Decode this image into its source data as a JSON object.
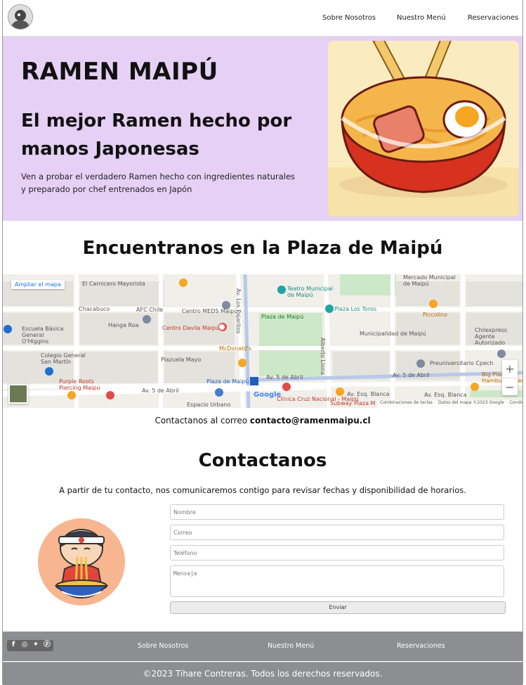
{
  "header": {
    "nav": [
      "Sobre Nosotros",
      "Nuestro Menú",
      "Reservaciones"
    ]
  },
  "hero": {
    "title": "RAMEN MAIPÚ",
    "subtitle": "El mejor Ramen hecho por manos Japonesas",
    "description": "Ven a probar el verdadero Ramen hecho con ingredientes naturales y preparado por chef entrenados en Japón"
  },
  "location": {
    "title": "Encuentranos en la Plaza de Maipú",
    "map": {
      "enlarge": "Ampliar el mapa",
      "labels": [
        "El Carnicero Mayorista",
        "Teatro Municipal de Maipú",
        "Mercado Municipal de Maipú",
        "Chacabuco",
        "AFC Chile",
        "Centro MEDS Maipú",
        "Plaza Los Toros",
        "Piccolino",
        "Escuela Básica General O'Higgins",
        "Hanga Roa",
        "Centro Davila Maipú",
        "Plaza de Maipú",
        "Municipalidad de Maipú",
        "Chilexpress Agente Autorizado",
        "McDonald's",
        "Colegio General San Martín",
        "Plazuela Mayo",
        "Preuniversitario Cpech",
        "Purple Roots Piercing Maipú",
        "Av. 5 de Abril",
        "Plaza de Maipú",
        "Av. 5 de Abril",
        "Av. 5 de Abril",
        "Big Plaza Hamburguesas",
        "Av. Esq. Blanca",
        "Av. Esq. Blanca",
        "Subway Plaza M",
        "Clínica Cruz Nacional - Maipú",
        "Espacio Urbano",
        "Av. Los Pajaritos",
        "Alberto Llona"
      ],
      "footer": [
        "Combinaciones de teclas",
        "Datos del mapa ©2023 Google",
        "Condiciones"
      ],
      "zoom_in": "+",
      "zoom_out": "−",
      "google": "Google"
    },
    "email_prefix": "Contactanos al correo",
    "email": "contacto@ramenmaipu.cl"
  },
  "contact": {
    "title": "Contactanos",
    "intro": "A partir de tu contacto, nos comunicaremos contigo para revisar fechas y disponibilidad de horarios.",
    "fields": {
      "name": "Nombre",
      "email": "Correo",
      "phone": "Teléfono",
      "message": "Mensaje"
    },
    "submit": "Enviar"
  },
  "footer": {
    "nav": [
      "Sobre Nosotros",
      "Nuestro Menú",
      "Reservaciones"
    ],
    "copyright": "©2023 Tihare Contreras. Todos los derechos reservados."
  },
  "colors": {
    "hero_bg": "#e6d0f5",
    "footer_bg": "#8c8e91"
  }
}
